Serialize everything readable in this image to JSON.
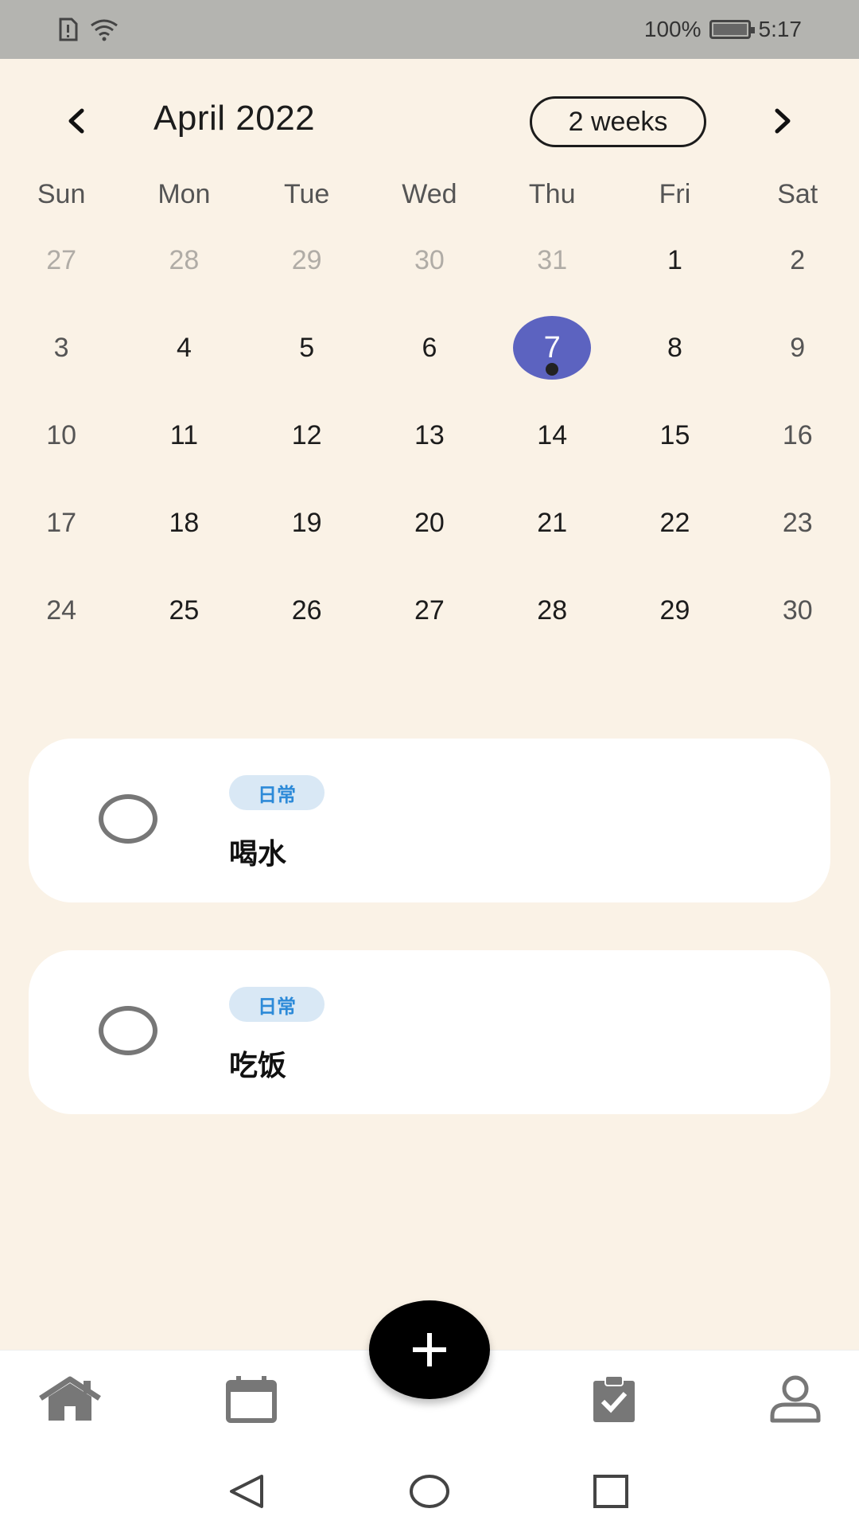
{
  "status_bar": {
    "battery_text": "100%",
    "time": "5:17",
    "icons": [
      "sim-alert-icon",
      "wifi-icon",
      "battery-icon"
    ]
  },
  "header": {
    "month_title": "April 2022",
    "range_label": "2 weeks",
    "prev_icon": "chevron-left-icon",
    "next_icon": "chevron-right-icon"
  },
  "weekdays": [
    "Sun",
    "Mon",
    "Tue",
    "Wed",
    "Thu",
    "Fri",
    "Sat"
  ],
  "weeks": [
    [
      "27",
      "28",
      "29",
      "30",
      "31",
      "1",
      "2"
    ],
    [
      "3",
      "4",
      "5",
      "6",
      "7",
      "8",
      "9"
    ],
    [
      "10",
      "11",
      "12",
      "13",
      "14",
      "15",
      "16"
    ],
    [
      "17",
      "18",
      "19",
      "20",
      "21",
      "22",
      "23"
    ],
    [
      "24",
      "25",
      "26",
      "27",
      "28",
      "29",
      "30"
    ]
  ],
  "selected_date": "7",
  "tasks": [
    {
      "tag": "日常",
      "title": "喝水"
    },
    {
      "tag": "日常",
      "title": "吃饭"
    }
  ],
  "bottom_nav": {
    "items": [
      "home-icon",
      "calendar-icon",
      "add-icon",
      "tasks-icon",
      "profile-icon"
    ]
  },
  "colors": {
    "background": "#faf2e6",
    "selected": "#5c63c0",
    "tag_bg": "#d9e8f5",
    "tag_text": "#2d8ad8",
    "fab": "#000000"
  }
}
